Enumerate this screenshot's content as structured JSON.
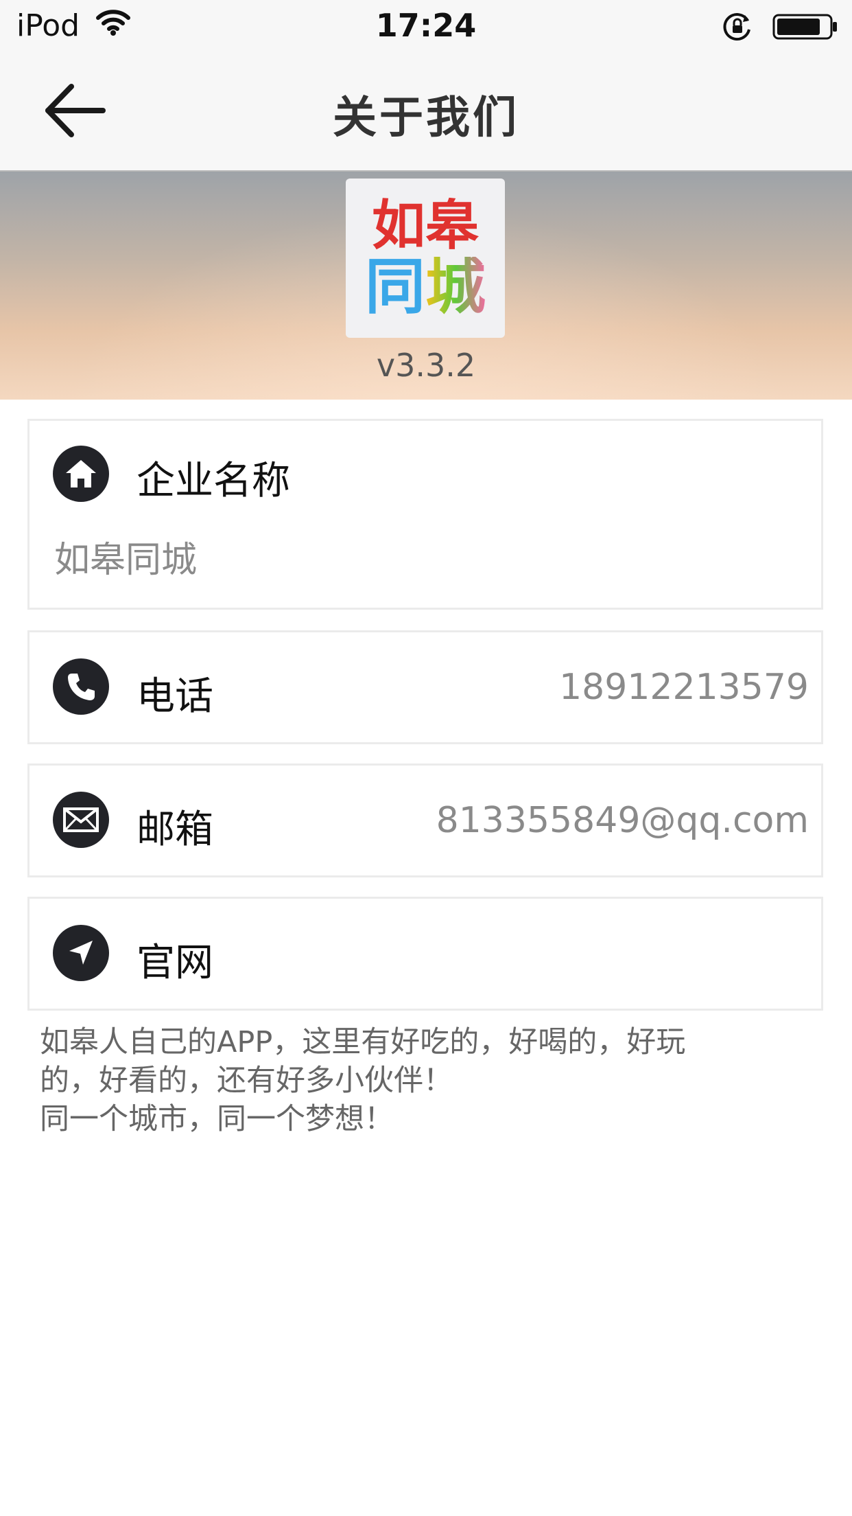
{
  "status_bar": {
    "carrier": "iPod",
    "time": "17:24"
  },
  "nav": {
    "title": "关于我们",
    "back_icon": "arrow-left-icon"
  },
  "hero": {
    "logo_text_top": [
      "如",
      "皋"
    ],
    "logo_text_bottom": [
      "同",
      "城"
    ],
    "version": "v3.3.2"
  },
  "company": {
    "label": "企业名称",
    "value": "如皋同城",
    "icon": "home-icon"
  },
  "phone": {
    "label": "电话",
    "value": "18912213579",
    "icon": "phone-icon"
  },
  "email": {
    "label": "邮箱",
    "value": "813355849@qq.com",
    "icon": "mail-icon"
  },
  "website": {
    "label": "官网",
    "value": "",
    "icon": "navigation-arrow-icon"
  },
  "description": "如皋人自己的APP，这里有好吃的，好喝的，好玩\n的，好看的，还有好多小伙伴！\n同一个城市，同一个梦想！",
  "colors": {
    "icon_bg": "#222328",
    "logo_red": "#e0322f",
    "logo_blue": "#3aa7e8",
    "logo_yellow": "#f2c21b",
    "logo_green": "#5fc83a",
    "logo_pink": "#f06aa0"
  }
}
